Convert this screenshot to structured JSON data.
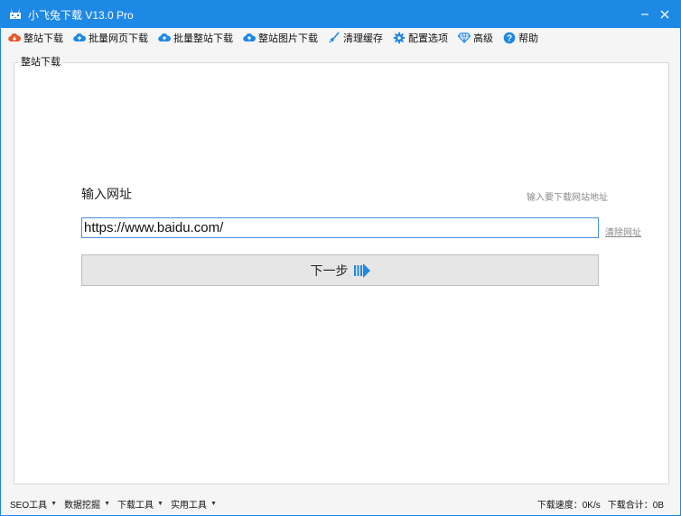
{
  "window": {
    "title": "小飞兔下载 V13.0 Pro",
    "accent_color": "#1e88e5"
  },
  "toolbar": {
    "items": [
      {
        "label": "整站下载",
        "icon": "cloud-download-icon",
        "color": "#e8562a"
      },
      {
        "label": "批量网页下载",
        "icon": "cloud-upload-icon",
        "color": "#1e88e5"
      },
      {
        "label": "批量整站下载",
        "icon": "cloud-upload-icon",
        "color": "#1e88e5"
      },
      {
        "label": "整站图片下载",
        "icon": "cloud-upload-icon",
        "color": "#1e88e5"
      },
      {
        "label": "清理缓存",
        "icon": "broom-icon",
        "color": "#1e88e5"
      },
      {
        "label": "配置选项",
        "icon": "gear-icon",
        "color": "#1e88e5"
      },
      {
        "label": "高级",
        "icon": "diamond-icon",
        "color": "#1e88e5"
      },
      {
        "label": "帮助",
        "icon": "help-icon",
        "color": "#1e88e5"
      }
    ]
  },
  "panel": {
    "group_title": "整站下载",
    "url_title": "输入网址",
    "url_hint": "输入要下载网站地址",
    "url_value": "https://www.baidu.com/",
    "clear_label": "清除网址",
    "next_label": "下一步"
  },
  "statusbar": {
    "menus": [
      {
        "label": "SEO工具"
      },
      {
        "label": "数据挖掘"
      },
      {
        "label": "下载工具"
      },
      {
        "label": "实用工具"
      }
    ],
    "speed": "下载速度：0K/s",
    "total": "下载合计：0B"
  }
}
